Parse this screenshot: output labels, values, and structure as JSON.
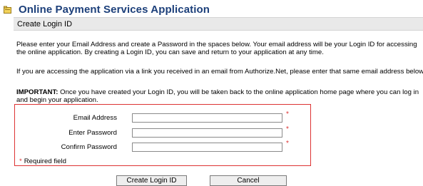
{
  "header": {
    "title": "Online Payment Services Application",
    "icon": "folder-icon",
    "color": "#1c3f7a"
  },
  "subheader": {
    "label": "Create Login ID"
  },
  "paragraphs": {
    "p1": "Please enter your Email Address and create a Password in the spaces below. Your email address will be your Login ID for accessing the online application. By creating a Login ID, you can save and return to your application at any time.",
    "p2": "If you are accessing the application via a link you received in an email from Authorize.Net, please enter that same email address below.",
    "p3_bold": "IMPORTANT:",
    "p3_rest": " Once you have created your Login ID, you will be taken back to the online application home page where you can log in and begin your application."
  },
  "form": {
    "email_label": "Email Address",
    "password_label": "Enter Password",
    "confirm_label": "Confirm Password",
    "required_star": "*",
    "required_note": "Required field",
    "email_value": "",
    "password_value": "",
    "confirm_value": ""
  },
  "buttons": {
    "create": "Create Login ID",
    "cancel": "Cancel"
  },
  "colors": {
    "required": "#dd3333",
    "border": "#dd3333",
    "subbar_bg": "#e9e9e9"
  }
}
